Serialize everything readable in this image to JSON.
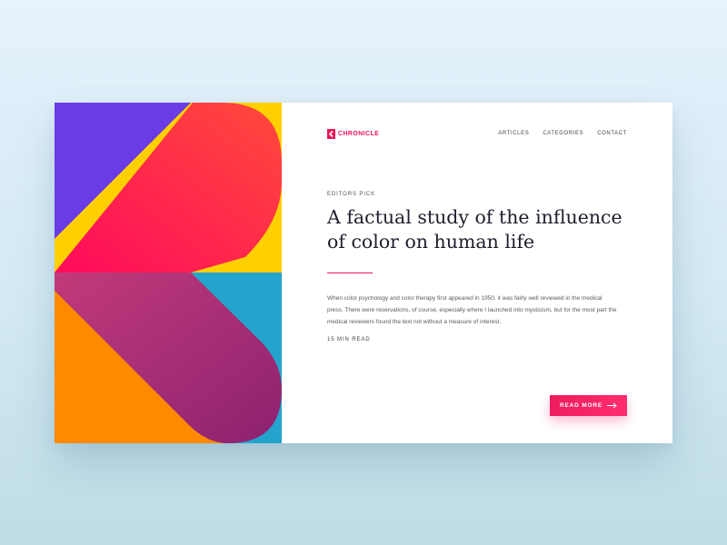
{
  "brand": {
    "name": "CHRONICLE"
  },
  "nav": {
    "items": [
      "ARTICLES",
      "CATEGORIES",
      "CONTACT"
    ]
  },
  "article": {
    "kicker": "EDITORS PICK",
    "title": "A factual study of the influence of color on human life",
    "excerpt": "When color psychology and color therapy first appeared in 1950, it was fairly well reviewed in the medical press. There were reservations, of course, especially where I launched into mysticism, but for the most part the medical reviewers found the text not without a measure of interest.",
    "read_time": "15 MIN READ",
    "cta_label": "READ MORE"
  },
  "icons": {
    "brand": "chevron-left-logo-icon",
    "cta": "arrow-right-icon"
  },
  "colors": {
    "accent": "#e8185a",
    "art_purple": "#6a3ce6",
    "art_yellow": "#ffd000",
    "art_orange": "#ff8a00",
    "art_blue": "#24a4cc",
    "art_pink": "#ff2e64",
    "art_magenta": "#a32a78"
  }
}
